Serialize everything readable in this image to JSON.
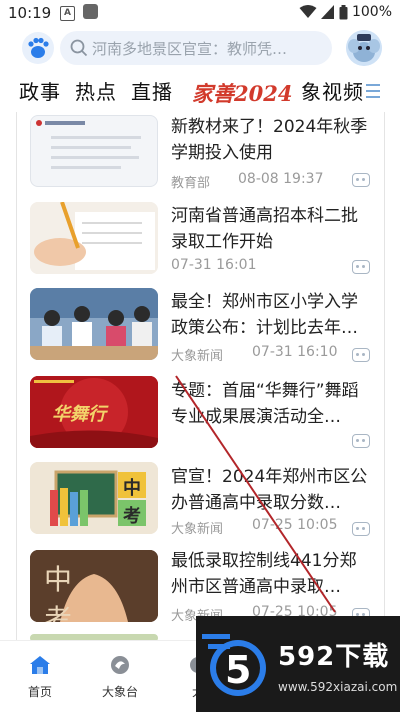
{
  "status_bar": {
    "time": "10:19",
    "notif_letter": "A",
    "battery": "100%"
  },
  "header": {
    "search_placeholder": "河南多地景区官宣：教师凭…"
  },
  "nav": {
    "tabs": [
      "政事",
      "热点",
      "直播",
      "象视频"
    ],
    "special_label": "家善2024"
  },
  "feed": [
    {
      "title": "新教材来了！2024年秋季学期投入使用",
      "source": "教育部",
      "time": "08-08 19:37"
    },
    {
      "title": "河南省普通高招本科二批录取工作开始",
      "source": "",
      "time": "07-31 16:01"
    },
    {
      "title": "最全！郑州市区小学入学政策公布：计划比去年…",
      "source": "大象新闻",
      "time": "07-31 16:10"
    },
    {
      "title": "专题：首届“华舞行”舞蹈专业成果展演活动全…",
      "source": "",
      "time": ""
    },
    {
      "title": "官宣！2024年郑州市区公办普通高中录取分数…",
      "source": "大象新闻",
      "time": "07-25 10:05"
    },
    {
      "title": "最低录取控制线441分郑州市区普通高中录取…",
      "source": "大象新闻",
      "time": "07-25 10:05"
    }
  ],
  "thumbs": {
    "t4_text": "华舞行",
    "t5_chars": [
      "中",
      "考"
    ],
    "t6_chars": "中 考"
  },
  "tabbar": {
    "tabs": [
      "首页",
      "大象台",
      "大"
    ]
  },
  "watermark": {
    "title": "592下载",
    "url": "www.592xiazai.com",
    "badge": "5"
  },
  "colors": {
    "accent": "#2b7de9",
    "special": "#d23a2c",
    "watermark_bg": "#1a1a1a"
  }
}
